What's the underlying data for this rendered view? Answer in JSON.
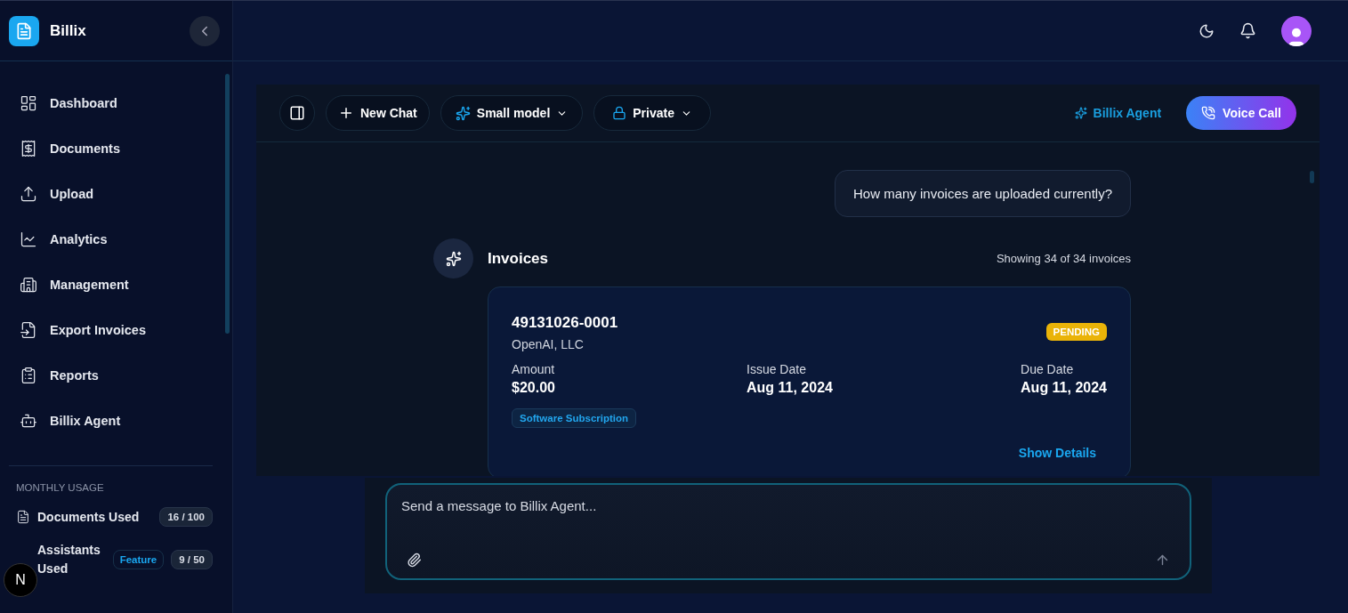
{
  "brand": {
    "name": "Billix"
  },
  "nav": [
    {
      "label": "Dashboard",
      "selected": false
    },
    {
      "label": "Documents",
      "selected": false
    },
    {
      "label": "Upload",
      "selected": false
    },
    {
      "label": "Analytics",
      "selected": false
    },
    {
      "label": "Management",
      "selected": false
    },
    {
      "label": "Export Invoices",
      "selected": false
    },
    {
      "label": "Reports",
      "selected": false
    },
    {
      "label": "Billix Agent",
      "selected": false
    }
  ],
  "usage": {
    "heading": "MONTHLY USAGE",
    "items": [
      {
        "label": "Documents Used",
        "count": "16 / 100"
      },
      {
        "label": "Assistants Used",
        "badge": "Feature",
        "count": "9 / 50"
      }
    ]
  },
  "dev_badge": "N",
  "toolbar": {
    "new_chat": "New Chat",
    "model": "Small model",
    "visibility": "Private",
    "agent": "Billix Agent",
    "call": "Voice Call"
  },
  "chat": {
    "user_message": "How many invoices are uploaded currently?",
    "result": {
      "title": "Invoices",
      "summary": "Showing 34 of 34 invoices",
      "invoices": [
        {
          "number": "49131026-0001",
          "vendor": "OpenAI, LLC",
          "status": "PENDING",
          "fields": [
            {
              "label": "Amount",
              "value": "$20.00"
            },
            {
              "label": "Issue Date",
              "value": "Aug 11, 2024"
            },
            {
              "label": "Due Date",
              "value": "Aug 11, 2024"
            }
          ],
          "category": "Software Subscription",
          "action": "Show Details"
        }
      ]
    }
  },
  "composer": {
    "placeholder": "Send a message to Billix Agent..."
  }
}
